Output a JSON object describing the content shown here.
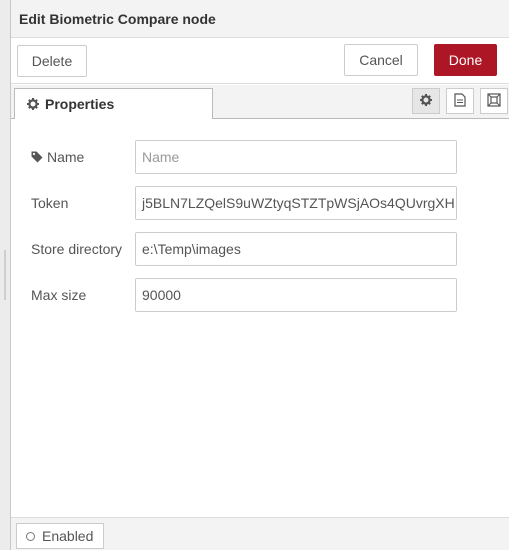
{
  "dialog": {
    "title": "Edit Biometric Compare node"
  },
  "toolbar": {
    "delete_label": "Delete",
    "cancel_label": "Cancel",
    "done_label": "Done",
    "done_color": "#ad1625"
  },
  "tabs": [
    {
      "label": "Properties",
      "icon": "gear-icon"
    }
  ],
  "tab_icons": [
    "gear-icon",
    "document-icon",
    "frame-icon"
  ],
  "fields": {
    "name": {
      "label": "Name",
      "icon": "tag-icon",
      "placeholder": "Name",
      "value": ""
    },
    "token": {
      "label": "Token",
      "value": "j5BLN7LZQelS9uWZtyqSTZTpWSjAOs4QUvrgXH"
    },
    "store_directory": {
      "label": "Store directory",
      "value": "e:\\Temp\\images"
    },
    "max_size": {
      "label": "Max size",
      "value": "90000"
    }
  },
  "footer": {
    "enabled_label": "Enabled"
  }
}
